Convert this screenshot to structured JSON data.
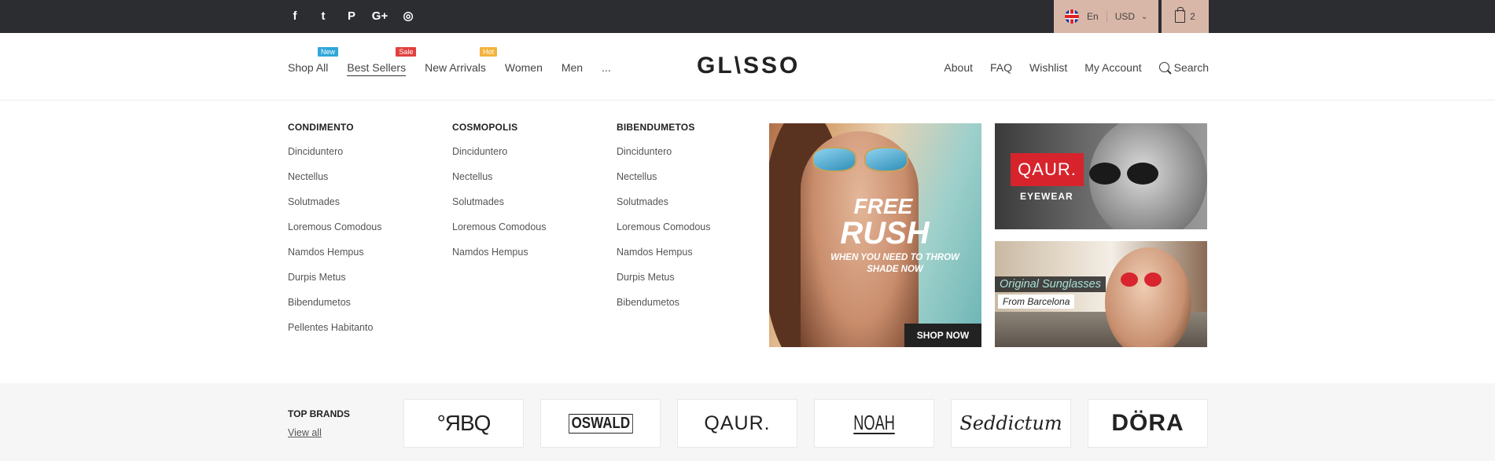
{
  "topbar": {
    "social_icons": [
      "facebook-icon",
      "twitter-icon",
      "pinterest-icon",
      "google-plus-icon",
      "instagram-icon"
    ],
    "social_glyphs": [
      "f",
      "t",
      "P",
      "G+",
      "◎"
    ],
    "language": "En",
    "currency": "USD",
    "cart_count": "2"
  },
  "nav_left": [
    {
      "label": "Shop All",
      "tag": "New",
      "tag_color": "#2fa7d8"
    },
    {
      "label": "Best Sellers",
      "tag": "Sale",
      "tag_color": "#e0413e"
    },
    {
      "label": "New Arrivals",
      "tag": "Hot",
      "tag_color": "#f3b33d"
    },
    {
      "label": "Women"
    },
    {
      "label": "Men"
    },
    {
      "label": "..."
    }
  ],
  "logo": "GL\\SSO",
  "nav_right": [
    "About",
    "FAQ",
    "Wishlist",
    "My Account",
    "Search"
  ],
  "mega_menu": {
    "columns": [
      {
        "title": "CONDIMENTO",
        "items": [
          "Dinciduntero",
          "Nectellus",
          "Solutmades",
          "Loremous Comodous",
          "Namdos Hempus",
          "Durpis Metus",
          "Bibendumetos",
          "Pellentes Habitanto"
        ]
      },
      {
        "title": "COSMOPOLIS",
        "items": [
          "Dinciduntero",
          "Nectellus",
          "Solutmades",
          "Loremous Comodous",
          "Namdos Hempus"
        ]
      },
      {
        "title": "BIBENDUMETOS",
        "items": [
          "Dinciduntero",
          "Nectellus",
          "Solutmades",
          "Loremous Comodous",
          "Namdos Hempus",
          "Durpis Metus",
          "Bibendumetos"
        ]
      }
    ],
    "promo_main": {
      "line1": "FREE",
      "line2": "RUSH",
      "subtitle": "WHEN YOU NEED TO THROW SHADE NOW",
      "button": "SHOP NOW"
    },
    "promo_top_right": {
      "brand": "QAUR.",
      "label": "EYEWEAR"
    },
    "promo_bottom_right": {
      "title": "Original Sunglasses",
      "subtitle": "From Barcelona"
    }
  },
  "brands": {
    "title": "TOP BRANDS",
    "view_all": "View all",
    "logos": [
      "°ЯBQ",
      "OSWALD",
      "QAUR.",
      "NOAH",
      "Seddictum",
      "DÖRA"
    ]
  }
}
